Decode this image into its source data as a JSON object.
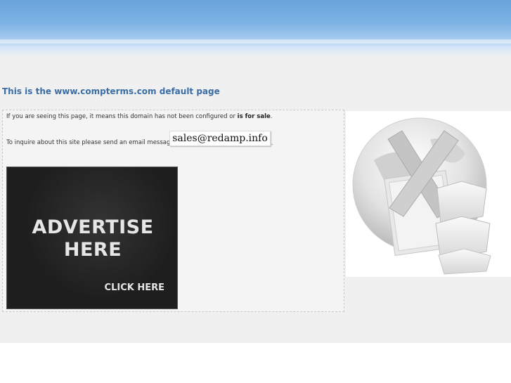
{
  "page": {
    "title": "This is the www.compterms.com default page"
  },
  "content": {
    "notice_prefix": "If you are seeing this page, it means this domain has not been configured or ",
    "notice_bold": "is for sale",
    "notice_suffix": ".",
    "inquiry_text": "To inquire about this site please send an email message to",
    "email": "sales@redamp.info",
    "inquiry_end": "."
  },
  "ad": {
    "headline": "ADVERTISE\nHERE",
    "cta": "CLICK HERE"
  },
  "icons": {
    "side_graphic": "globe-with-x-and-folders-icon"
  },
  "colors": {
    "title": "#3a6ea5",
    "banner": "#7cb2e4",
    "background": "#f0f0f0"
  }
}
